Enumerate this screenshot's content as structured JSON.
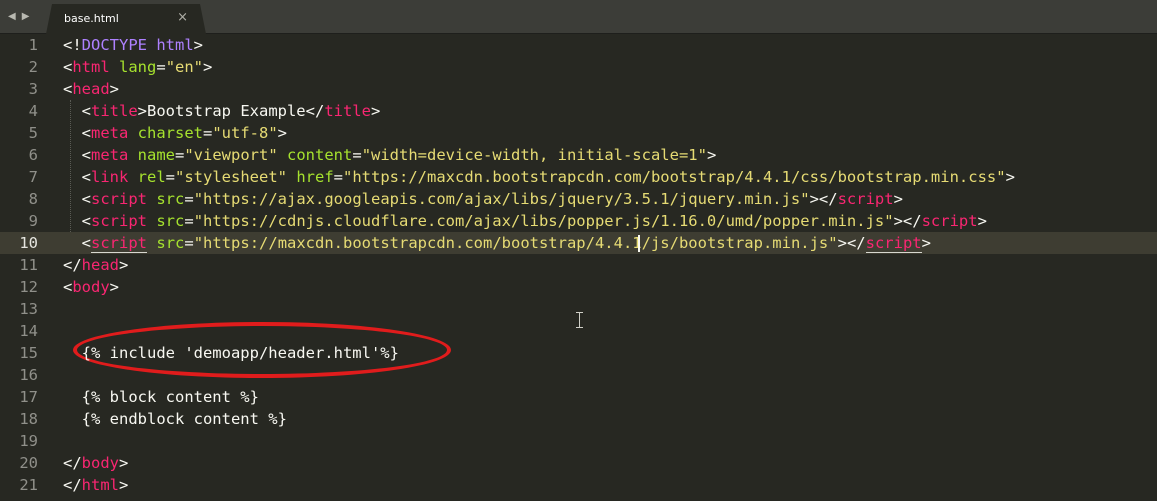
{
  "tab": {
    "title": "base.html",
    "close_glyph": "×"
  },
  "nav": {
    "back": "◀",
    "forward": "▶"
  },
  "lines": [
    {
      "n": "1",
      "tokens": [
        [
          "w",
          "<!"
        ],
        [
          "d",
          "DOCTYPE"
        ],
        [
          "w",
          " "
        ],
        [
          "d",
          "html"
        ],
        [
          "w",
          ">"
        ]
      ]
    },
    {
      "n": "2",
      "tokens": [
        [
          "w",
          "<"
        ],
        [
          "t",
          "html"
        ],
        [
          "w",
          " "
        ],
        [
          "a",
          "lang"
        ],
        [
          "w",
          "="
        ],
        [
          "s",
          "\"en\""
        ],
        [
          "w",
          ">"
        ]
      ]
    },
    {
      "n": "3",
      "tokens": [
        [
          "w",
          "<"
        ],
        [
          "t",
          "head"
        ],
        [
          "w",
          ">"
        ]
      ]
    },
    {
      "n": "4",
      "tokens": [
        [
          "w",
          "  <"
        ],
        [
          "t",
          "title"
        ],
        [
          "w",
          ">Bootstrap Example</"
        ],
        [
          "t",
          "title"
        ],
        [
          "w",
          ">"
        ]
      ]
    },
    {
      "n": "5",
      "tokens": [
        [
          "w",
          "  <"
        ],
        [
          "t",
          "meta"
        ],
        [
          "w",
          " "
        ],
        [
          "a",
          "charset"
        ],
        [
          "w",
          "="
        ],
        [
          "s",
          "\"utf-8\""
        ],
        [
          "w",
          ">"
        ]
      ]
    },
    {
      "n": "6",
      "tokens": [
        [
          "w",
          "  <"
        ],
        [
          "t",
          "meta"
        ],
        [
          "w",
          " "
        ],
        [
          "a",
          "name"
        ],
        [
          "w",
          "="
        ],
        [
          "s",
          "\"viewport\""
        ],
        [
          "w",
          " "
        ],
        [
          "a",
          "content"
        ],
        [
          "w",
          "="
        ],
        [
          "s",
          "\"width=device-width, initial-scale=1\""
        ],
        [
          "w",
          ">"
        ]
      ]
    },
    {
      "n": "7",
      "tokens": [
        [
          "w",
          "  <"
        ],
        [
          "t",
          "link"
        ],
        [
          "w",
          " "
        ],
        [
          "a",
          "rel"
        ],
        [
          "w",
          "="
        ],
        [
          "s",
          "\"stylesheet\""
        ],
        [
          "w",
          " "
        ],
        [
          "a",
          "href"
        ],
        [
          "w",
          "="
        ],
        [
          "s",
          "\"https://maxcdn.bootstrapcdn.com/bootstrap/4.4.1/css/bootstrap.min.css\""
        ],
        [
          "w",
          ">"
        ]
      ]
    },
    {
      "n": "8",
      "tokens": [
        [
          "w",
          "  <"
        ],
        [
          "t",
          "script"
        ],
        [
          "w",
          " "
        ],
        [
          "a",
          "src"
        ],
        [
          "w",
          "="
        ],
        [
          "s",
          "\"https://ajax.googleapis.com/ajax/libs/jquery/3.5.1/jquery.min.js\""
        ],
        [
          "w",
          "></"
        ],
        [
          "t",
          "script"
        ],
        [
          "w",
          ">"
        ]
      ]
    },
    {
      "n": "9",
      "tokens": [
        [
          "w",
          "  <"
        ],
        [
          "t",
          "script"
        ],
        [
          "w",
          " "
        ],
        [
          "a",
          "src"
        ],
        [
          "w",
          "="
        ],
        [
          "s",
          "\"https://cdnjs.cloudflare.com/ajax/libs/popper.js/1.16.0/umd/popper.min.js\""
        ],
        [
          "w",
          "></"
        ],
        [
          "t",
          "script"
        ],
        [
          "w",
          ">"
        ]
      ]
    },
    {
      "n": "10",
      "current": true,
      "tokens": [
        [
          "w",
          "  "
        ],
        [
          "w",
          "<"
        ],
        [
          "tm",
          "script"
        ],
        [
          "w",
          " "
        ],
        [
          "a",
          "src"
        ],
        [
          "w",
          "="
        ],
        [
          "s",
          "\"https://maxcdn.bootstrapcdn.com/bootstrap/4.4.1/js/bootstrap.min.js\""
        ],
        [
          "w",
          ">"
        ],
        [
          "w",
          "</"
        ],
        [
          "tm",
          "script"
        ],
        [
          "w",
          ">"
        ]
      ]
    },
    {
      "n": "11",
      "tokens": [
        [
          "w",
          "</"
        ],
        [
          "t",
          "head"
        ],
        [
          "w",
          ">"
        ]
      ]
    },
    {
      "n": "12",
      "tokens": [
        [
          "w",
          "<"
        ],
        [
          "t",
          "body"
        ],
        [
          "w",
          ">"
        ]
      ]
    },
    {
      "n": "13",
      "tokens": []
    },
    {
      "n": "14",
      "tokens": []
    },
    {
      "n": "15",
      "tokens": [
        [
          "w",
          "  {% include 'demoapp/header.html'%}"
        ]
      ]
    },
    {
      "n": "16",
      "tokens": []
    },
    {
      "n": "17",
      "tokens": [
        [
          "w",
          "  {% block content %}"
        ]
      ]
    },
    {
      "n": "18",
      "tokens": [
        [
          "w",
          "  {% endblock content %}"
        ]
      ]
    },
    {
      "n": "19",
      "tokens": []
    },
    {
      "n": "20",
      "tokens": [
        [
          "w",
          "</"
        ],
        [
          "t",
          "body"
        ],
        [
          "w",
          ">"
        ]
      ]
    },
    {
      "n": "21",
      "tokens": [
        [
          "w",
          "</"
        ],
        [
          "t",
          "html"
        ],
        [
          "w",
          ">"
        ]
      ]
    }
  ],
  "colors": {
    "background": "#272822",
    "tag": "#f92672",
    "attribute": "#a6e22e",
    "string": "#e6db74",
    "doctype": "#ae81ff",
    "annotation": "#e01c1c"
  }
}
